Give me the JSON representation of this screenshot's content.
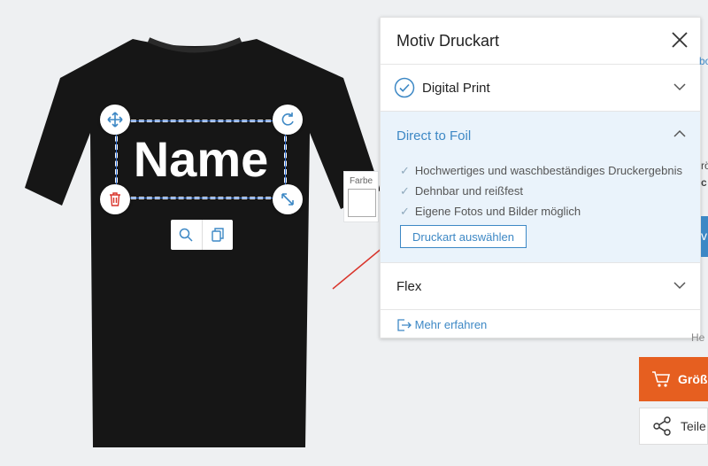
{
  "design": {
    "text": "Name"
  },
  "color_picker": {
    "label": "Farbe",
    "value": "#ffffff"
  },
  "panel": {
    "title": "Motiv Druckart",
    "options": [
      {
        "label": "Digital Print",
        "selected": true
      },
      {
        "label": "Direct to Foil",
        "expanded": true
      },
      {
        "label": "Flex"
      }
    ],
    "expanded": {
      "title": "Direct to Foil",
      "features": [
        "Hochwertiges und waschbeständiges Druckergebnis",
        "Dehnbar und reißfest",
        "Eigene Fotos und Bilder möglich"
      ],
      "button_label": "Druckart auswählen"
    },
    "learn_more": "Mehr erfahren"
  },
  "right_side": {
    "cart_label": "Größ",
    "share_label": "Teile",
    "edge_fragments": [
      "bo",
      "rö",
      "c",
      "v",
      "He"
    ]
  },
  "colors": {
    "accent": "#3d88c5",
    "cart": "#e65f20",
    "shirt": "#161616",
    "arrow": "#d9342b"
  }
}
